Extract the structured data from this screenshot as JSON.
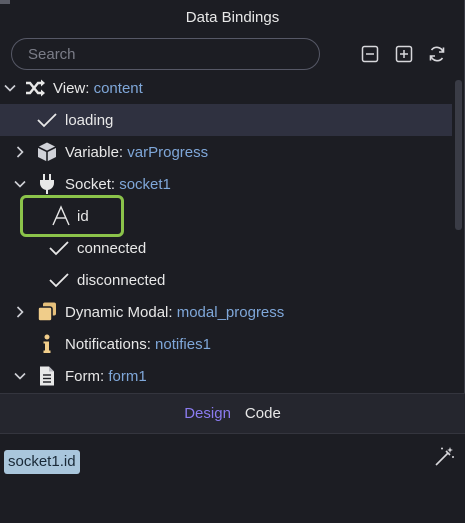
{
  "panel": {
    "title": "Data Bindings"
  },
  "search": {
    "placeholder": "Search"
  },
  "toolbar": {
    "collapse_icon": "minus-square-icon",
    "expand_icon": "plus-square-icon",
    "refresh_icon": "refresh-icon"
  },
  "tree": {
    "items": [
      {
        "kind": "View",
        "sep": ": ",
        "value": "content",
        "expanded": true,
        "icon": "shuffle-icon"
      },
      {
        "label": "loading",
        "icon": "check-icon",
        "selected": true
      },
      {
        "kind": "Variable",
        "sep": ": ",
        "value": "varProgress",
        "expanded": false,
        "icon": "cube-icon"
      },
      {
        "kind": "Socket",
        "sep": ": ",
        "value": "socket1",
        "expanded": true,
        "icon": "plug-icon"
      },
      {
        "label": "id",
        "icon": "text-a-icon",
        "highlighted": true
      },
      {
        "label": "connected",
        "icon": "check-icon"
      },
      {
        "label": "disconnected",
        "icon": "check-icon"
      },
      {
        "kind": "Dynamic Modal",
        "sep": ": ",
        "value": "modal_progress",
        "expanded": false,
        "icon": "stacked-windows-icon"
      },
      {
        "kind": "Notifications",
        "sep": ": ",
        "value": "notifies1",
        "icon": "info-icon"
      },
      {
        "kind": "Form",
        "sep": ": ",
        "value": "form1",
        "expanded": true,
        "icon": "document-icon"
      }
    ]
  },
  "tabs": [
    {
      "label": "Design",
      "active": true
    },
    {
      "label": "Code",
      "active": false
    }
  ],
  "editor": {
    "token": "socket1.id",
    "wand_icon": "magic-wand-icon"
  },
  "colors": {
    "accent": "#8b7bf0",
    "value_text": "#7fa7d9",
    "highlight_border": "#8bc34a",
    "token_bg": "#a9c6dc",
    "background": "#1c1d23"
  }
}
